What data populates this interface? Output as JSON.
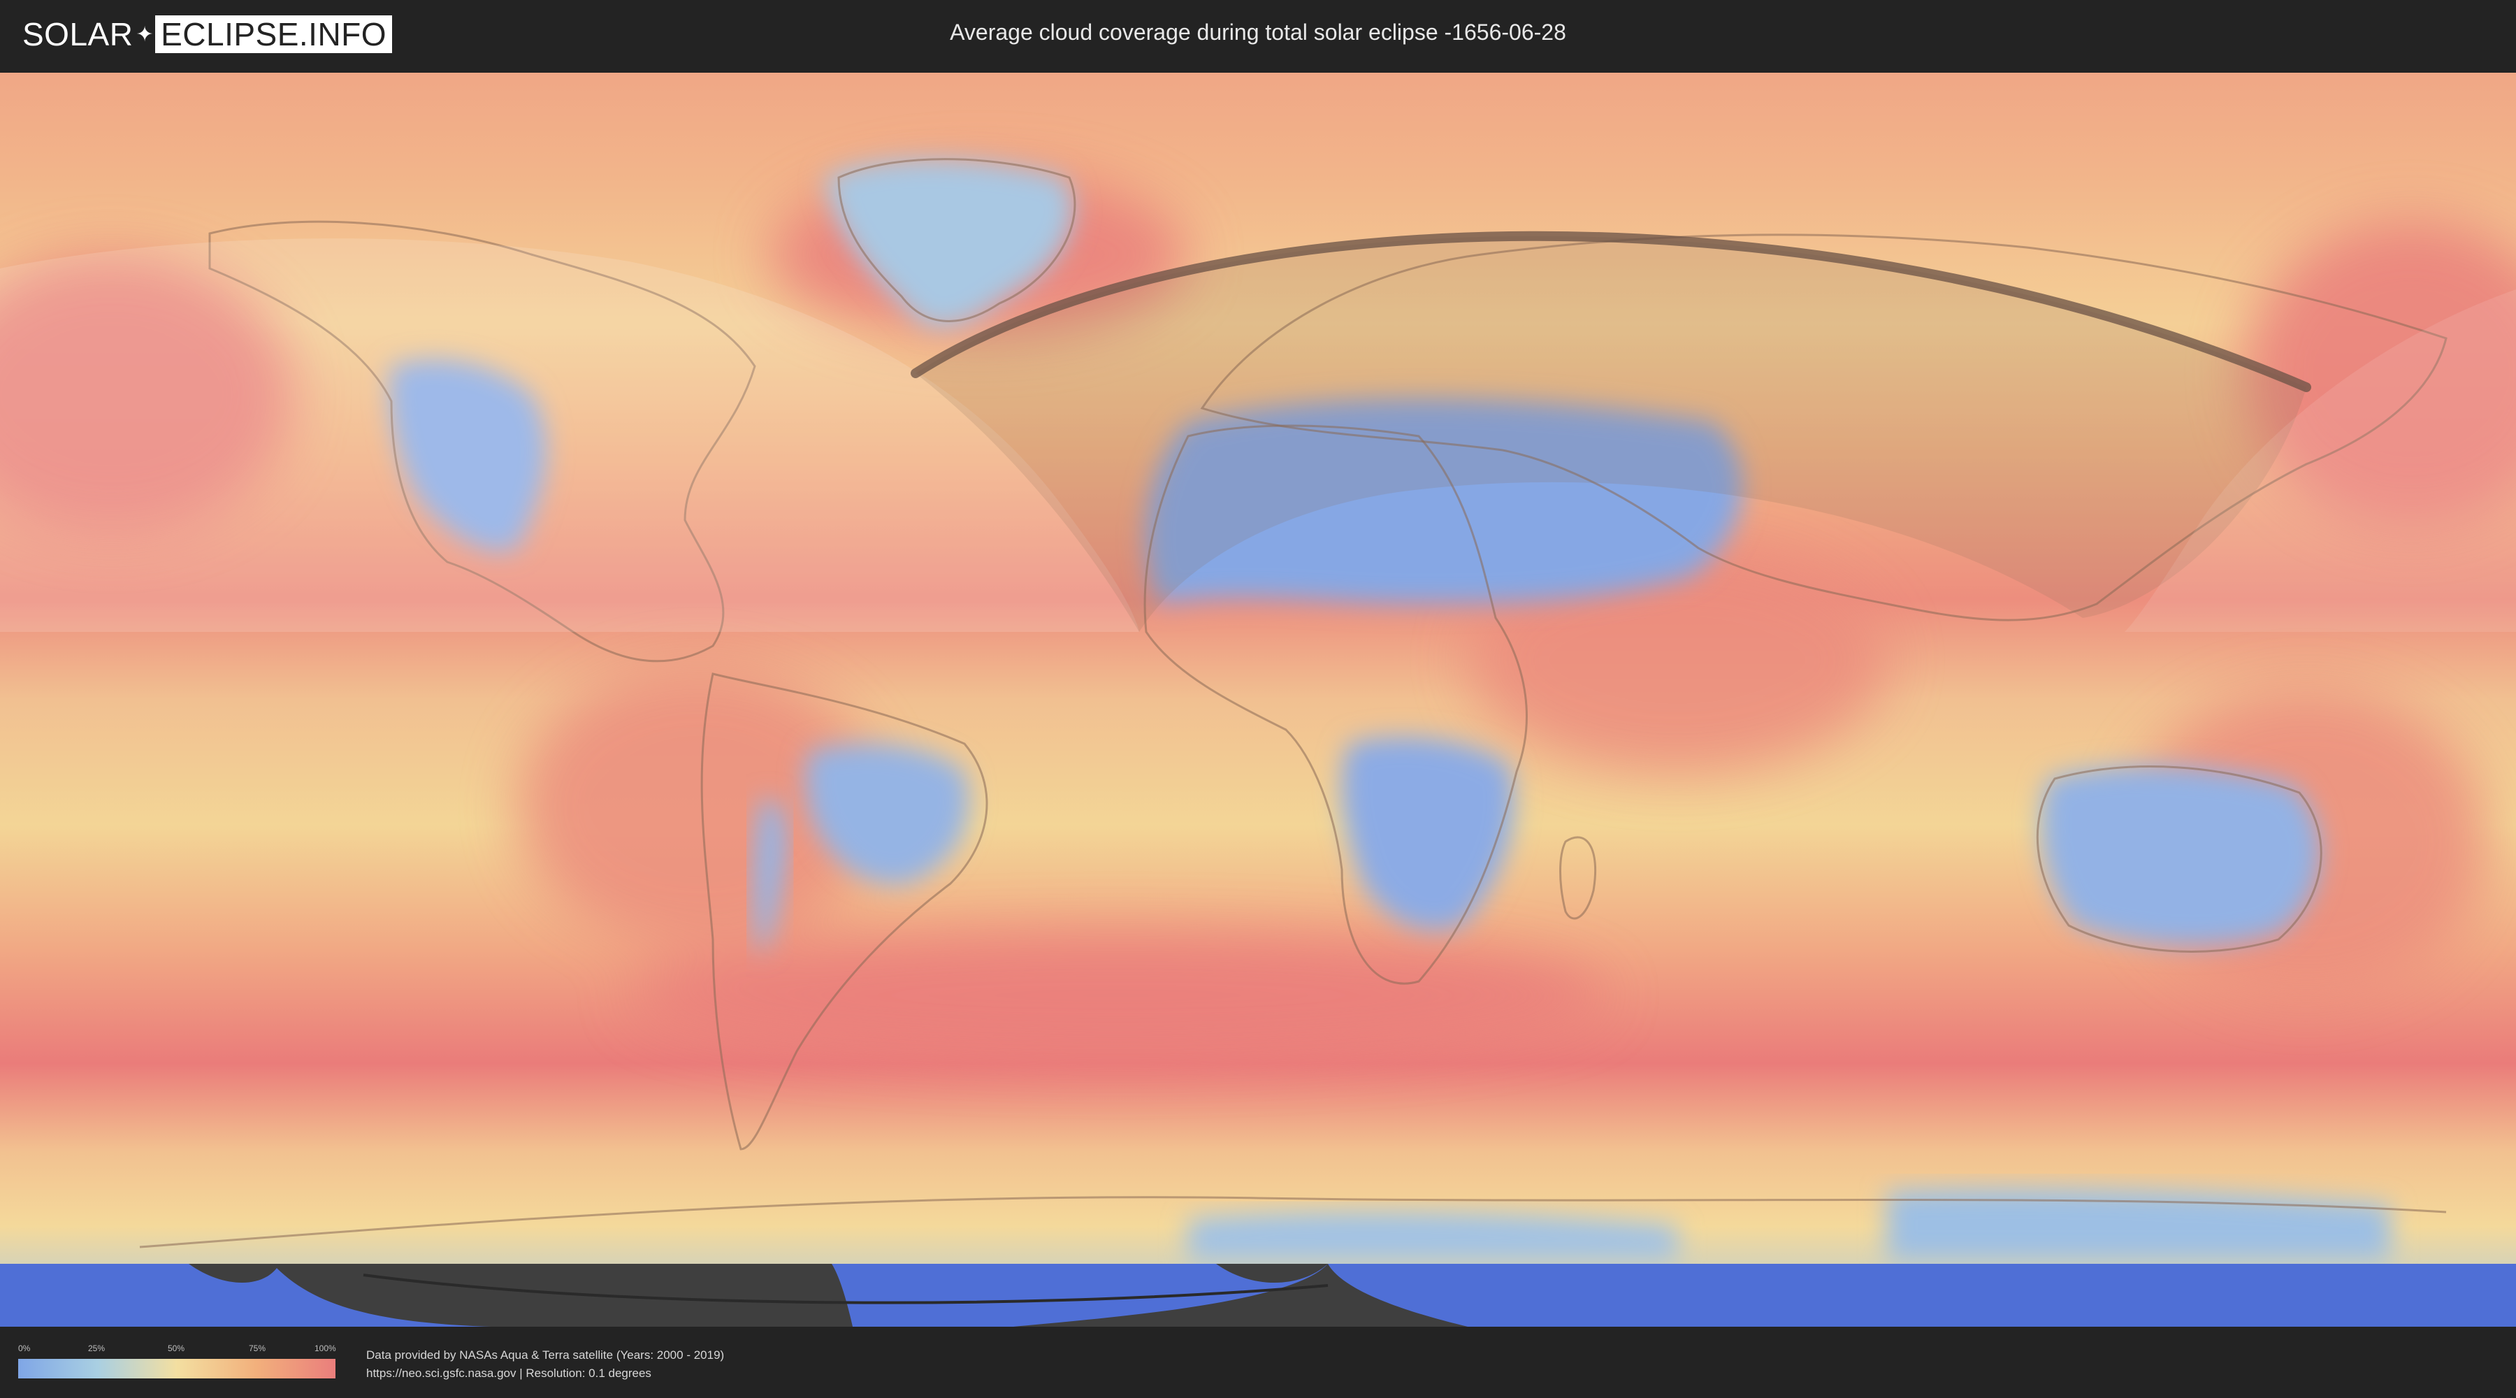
{
  "header": {
    "logo_part1": "SOLAR",
    "logo_part2": "ECLIPSE.INFO",
    "title": "Average cloud coverage during total solar eclipse -1656-06-28"
  },
  "legend": {
    "ticks": [
      "0%",
      "25%",
      "50%",
      "75%",
      "100%"
    ],
    "scale_colors": [
      "#7fa6e6",
      "#a9cfe2",
      "#f3dfa1",
      "#f2b07c",
      "#ea7e7c"
    ]
  },
  "footer": {
    "line1": "Data provided by NASAs Aqua & Terra satellite (Years: 2000 - 2019)",
    "line2": "https://neo.sci.gsfc.nasa.gov | Resolution: 0.1 degrees"
  },
  "colors": {
    "background": "#232323",
    "ocean_cloudy": "#ea7e7c",
    "land_clear": "#7fa6e6",
    "antarctica": "#4f6fd6"
  },
  "icons": {
    "logo_mark": "eclipse-star-icon"
  }
}
